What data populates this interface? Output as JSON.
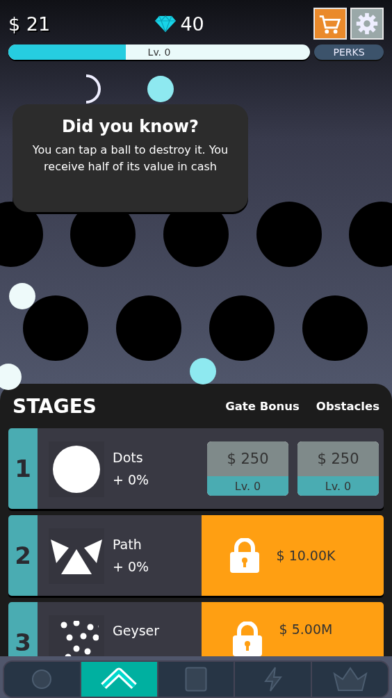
{
  "header": {
    "cash": "$ 21",
    "gems": "40",
    "level": 0.39,
    "level_label": "Lv. 0",
    "perks": "PERKS"
  },
  "tip": {
    "title": "Did you know?",
    "text": "You can tap a ball to destroy it. You receive half of its value in cash"
  },
  "stages": {
    "title": "STAGES",
    "columns": [
      "Gate Bonus",
      "Obstacles"
    ],
    "rows": [
      {
        "kind": "unlocked",
        "number": "1",
        "name": "Dots",
        "bonus": "+ 0%",
        "upgrades": [
          {
            "price": "$ 250",
            "level_label": "Lv. 0"
          },
          {
            "price": "$ 250",
            "level_label": "Lv. 0"
          }
        ]
      },
      {
        "kind": "locked",
        "number": "2",
        "name": "Path",
        "bonus": "+ 0%",
        "price": "$ 10.00K"
      },
      {
        "kind": "locked",
        "number": "3",
        "name": "Geyser",
        "price": "$ 5.00M"
      }
    ]
  },
  "nav": [
    {
      "selected": false
    },
    {
      "selected": true
    },
    {
      "selected": false
    },
    {
      "selected": false
    },
    {
      "selected": false
    }
  ]
}
